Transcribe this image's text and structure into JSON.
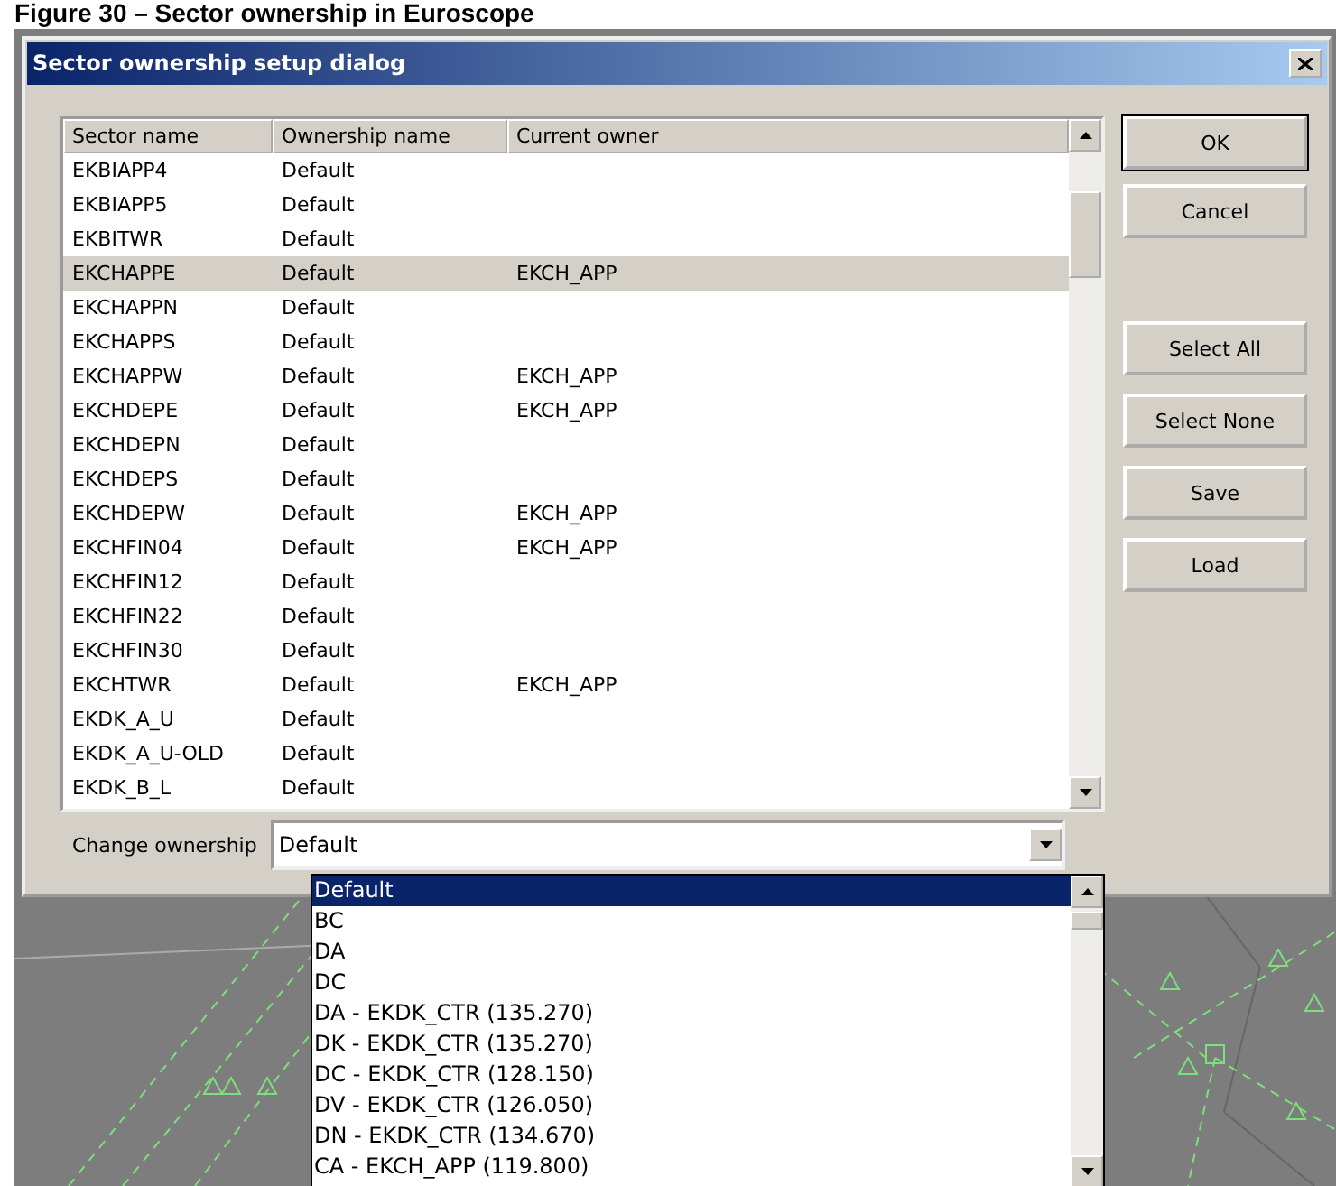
{
  "caption": "Figure 30 – Sector ownership in Euroscope",
  "window": {
    "title": "Sector ownership setup dialog"
  },
  "table": {
    "columns": [
      "Sector name",
      "Ownership name",
      "Current owner"
    ],
    "rows": [
      {
        "cells": [
          "EKBIAPP4",
          "Default",
          ""
        ],
        "selected": false
      },
      {
        "cells": [
          "EKBIAPP5",
          "Default",
          ""
        ],
        "selected": false
      },
      {
        "cells": [
          "EKBITWR",
          "Default",
          ""
        ],
        "selected": false
      },
      {
        "cells": [
          "EKCHAPPE",
          "Default",
          "EKCH_APP"
        ],
        "selected": true
      },
      {
        "cells": [
          "EKCHAPPN",
          "Default",
          ""
        ],
        "selected": false
      },
      {
        "cells": [
          "EKCHAPPS",
          "Default",
          ""
        ],
        "selected": false
      },
      {
        "cells": [
          "EKCHAPPW",
          "Default",
          "EKCH_APP"
        ],
        "selected": false
      },
      {
        "cells": [
          "EKCHDEPE",
          "Default",
          "EKCH_APP"
        ],
        "selected": false
      },
      {
        "cells": [
          "EKCHDEPN",
          "Default",
          ""
        ],
        "selected": false
      },
      {
        "cells": [
          "EKCHDEPS",
          "Default",
          ""
        ],
        "selected": false
      },
      {
        "cells": [
          "EKCHDEPW",
          "Default",
          "EKCH_APP"
        ],
        "selected": false
      },
      {
        "cells": [
          "EKCHFIN04",
          "Default",
          "EKCH_APP"
        ],
        "selected": false
      },
      {
        "cells": [
          "EKCHFIN12",
          "Default",
          ""
        ],
        "selected": false
      },
      {
        "cells": [
          "EKCHFIN22",
          "Default",
          ""
        ],
        "selected": false
      },
      {
        "cells": [
          "EKCHFIN30",
          "Default",
          ""
        ],
        "selected": false
      },
      {
        "cells": [
          "EKCHTWR",
          "Default",
          "EKCH_APP"
        ],
        "selected": false
      },
      {
        "cells": [
          "EKDK_A_U",
          "Default",
          ""
        ],
        "selected": false
      },
      {
        "cells": [
          "EKDK_A_U-OLD",
          "Default",
          ""
        ],
        "selected": false
      },
      {
        "cells": [
          "EKDK_B_L",
          "Default",
          ""
        ],
        "selected": false
      }
    ]
  },
  "buttons": [
    {
      "label": "OK",
      "default": true
    },
    {
      "label": "Cancel",
      "default": false
    }
  ],
  "selection_buttons": [
    {
      "label": "Select All",
      "default": false
    },
    {
      "label": "Select None",
      "default": false
    },
    {
      "label": "Save",
      "default": false
    },
    {
      "label": "Load",
      "default": false
    }
  ],
  "change_ownership": {
    "label": "Change ownership",
    "value": "Default",
    "options": [
      {
        "label": "Default",
        "selected": true
      },
      {
        "label": "BC",
        "selected": false
      },
      {
        "label": "DA",
        "selected": false
      },
      {
        "label": "DC",
        "selected": false
      },
      {
        "label": "DA - EKDK_CTR (135.270)",
        "selected": false
      },
      {
        "label": "DK - EKDK_CTR (135.270)",
        "selected": false
      },
      {
        "label": "DC - EKDK_CTR (128.150)",
        "selected": false
      },
      {
        "label": "DV - EKDK_CTR (126.050)",
        "selected": false
      },
      {
        "label": "DN - EKDK_CTR (134.670)",
        "selected": false
      },
      {
        "label": "CA - EKCH_APP (119.800)",
        "selected": false
      }
    ]
  }
}
